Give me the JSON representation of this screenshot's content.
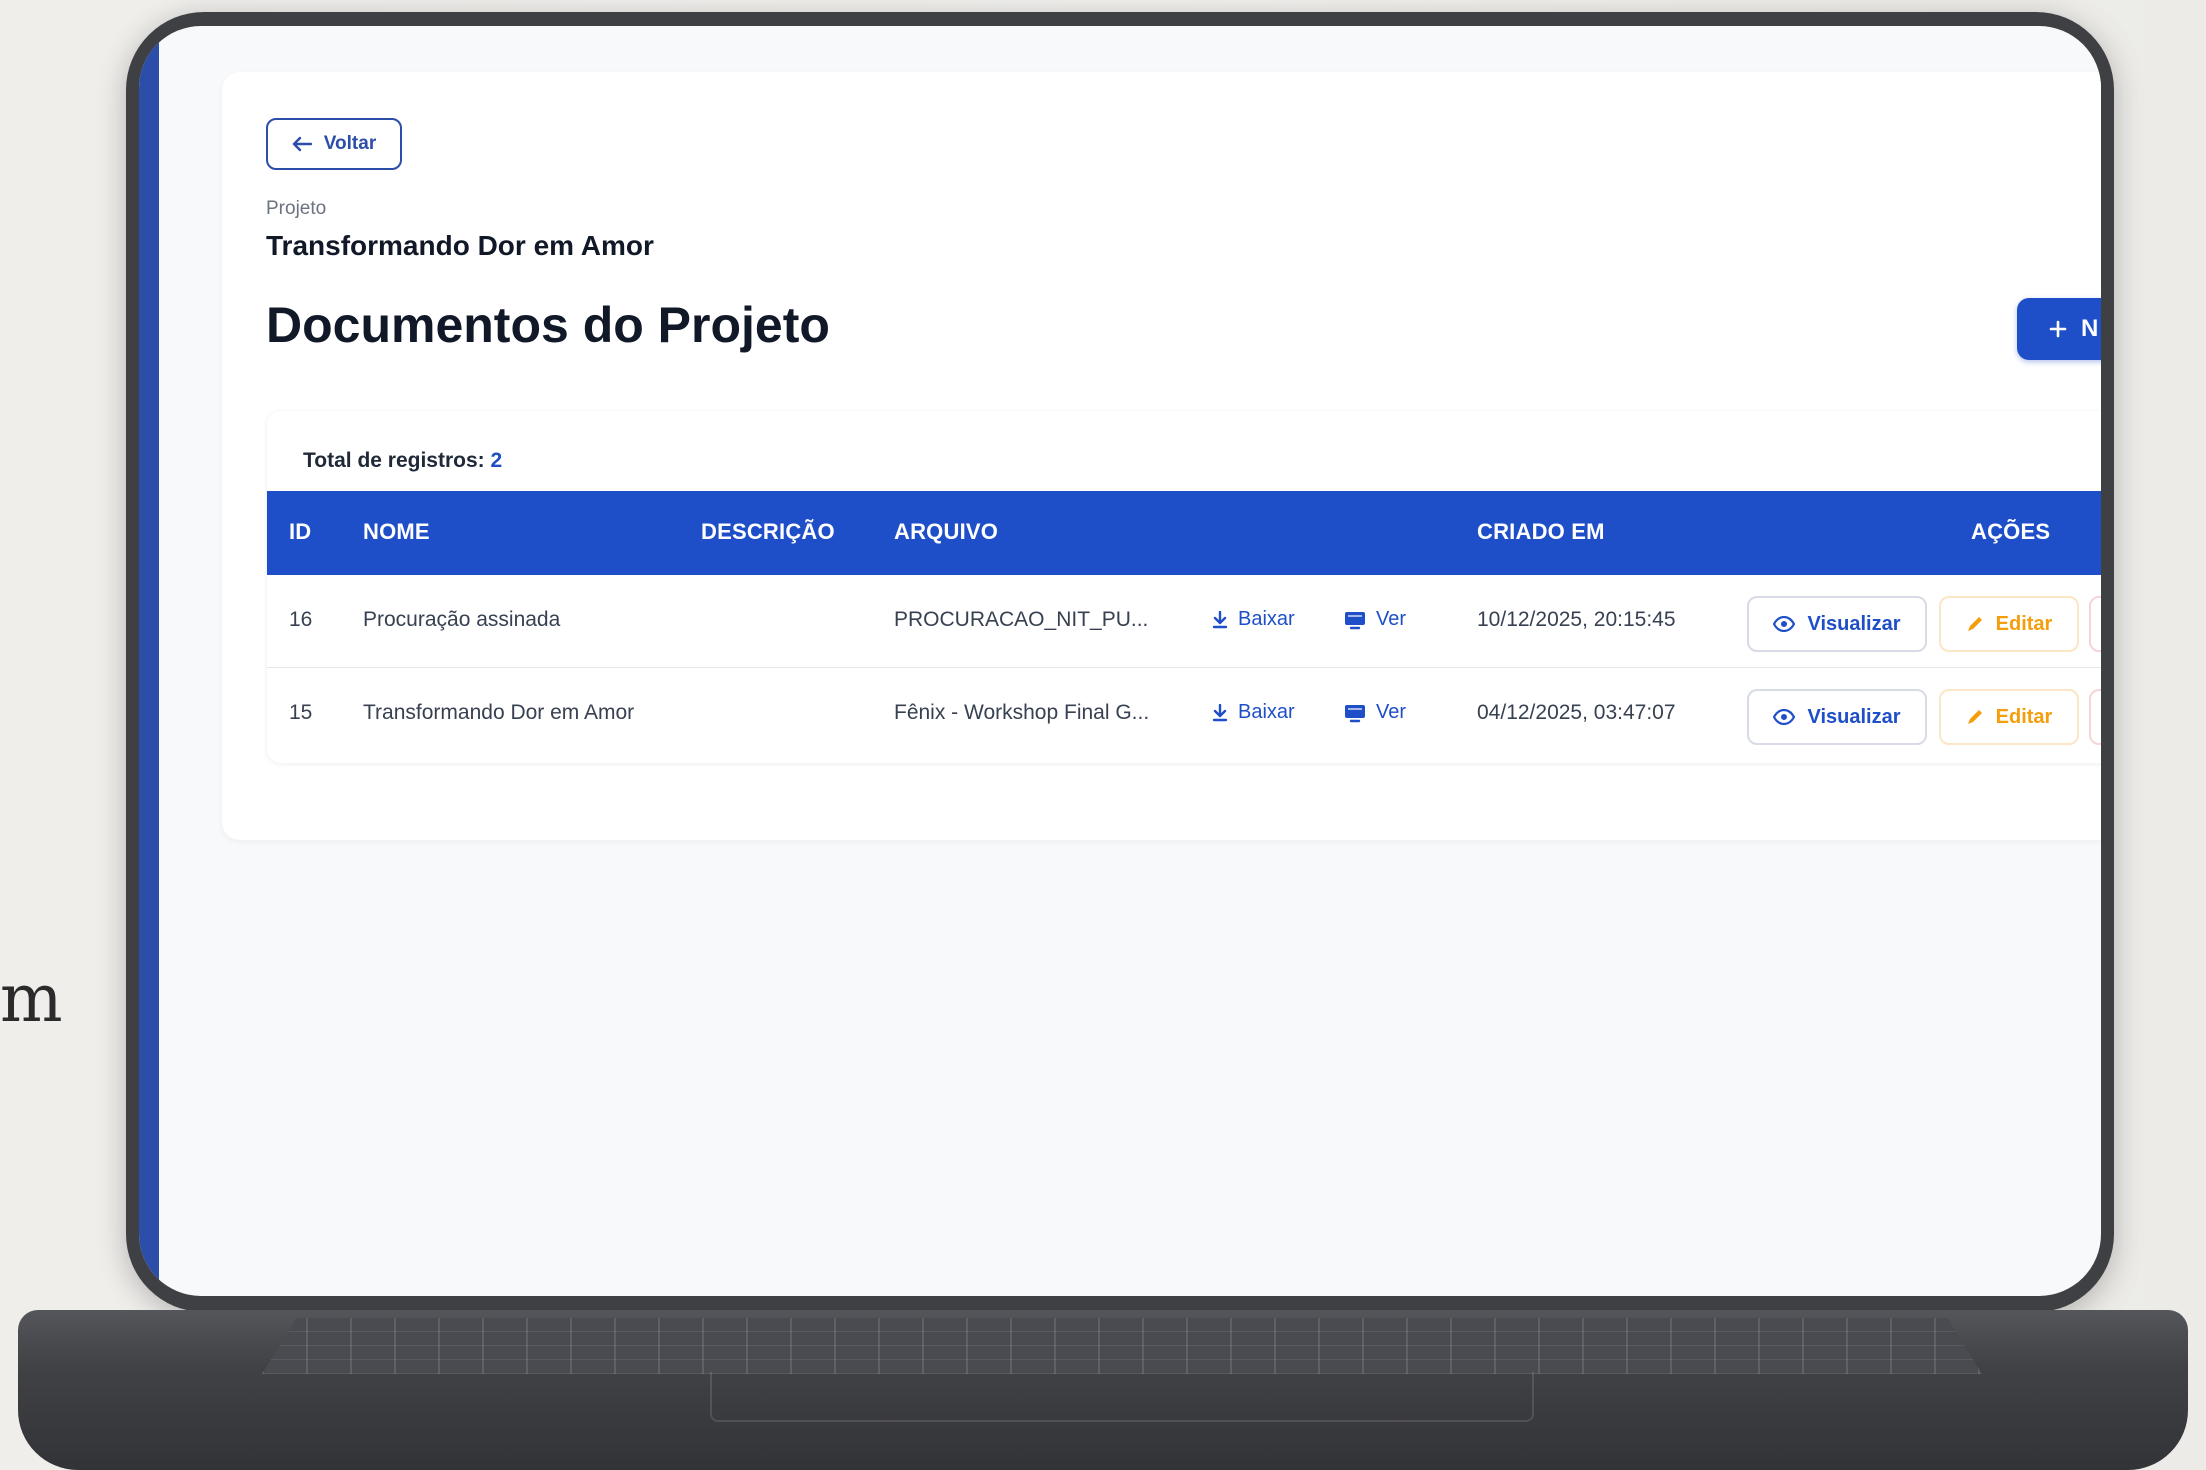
{
  "background": {
    "text_fragment": "m"
  },
  "header": {
    "back_label": "Voltar",
    "project_kicker": "Projeto",
    "project_name": "Transformando Dor em Amor",
    "page_title": "Documentos do Projeto",
    "new_button_label": "N"
  },
  "table": {
    "total_label": "Total de registros:",
    "total_count": "2",
    "columns": {
      "id": "ID",
      "nome": "NOME",
      "descricao": "DESCRIÇÃO",
      "arquivo": "ARQUIVO",
      "criado_em": "CRIADO EM",
      "acoes": "AÇÕES"
    },
    "rows": [
      {
        "id": "16",
        "nome": "Procuração assinada",
        "descricao": "",
        "arquivo": "PROCURACAO_NIT_PU...",
        "download_label": "Baixar",
        "view_label": "Ver",
        "criado_em": "10/12/2025, 20:15:45",
        "visualizar_label": "Visualizar",
        "editar_label": "Editar"
      },
      {
        "id": "15",
        "nome": "Transformando Dor em Amor",
        "descricao": "",
        "arquivo": "Fênix - Workshop Final G...",
        "download_label": "Baixar",
        "view_label": "Ver",
        "criado_em": "04/12/2025, 03:47:07",
        "visualizar_label": "Visualizar",
        "editar_label": "Editar"
      }
    ]
  },
  "colors": {
    "primary": "#1f4fc8",
    "warning": "#f59e0b",
    "bezel": "#3f4044"
  },
  "icons": {
    "back": "arrow-left-icon",
    "new": "plus-icon",
    "download": "download-icon",
    "view": "monitor-icon",
    "visualizar": "eye-icon",
    "editar": "pencil-icon"
  }
}
